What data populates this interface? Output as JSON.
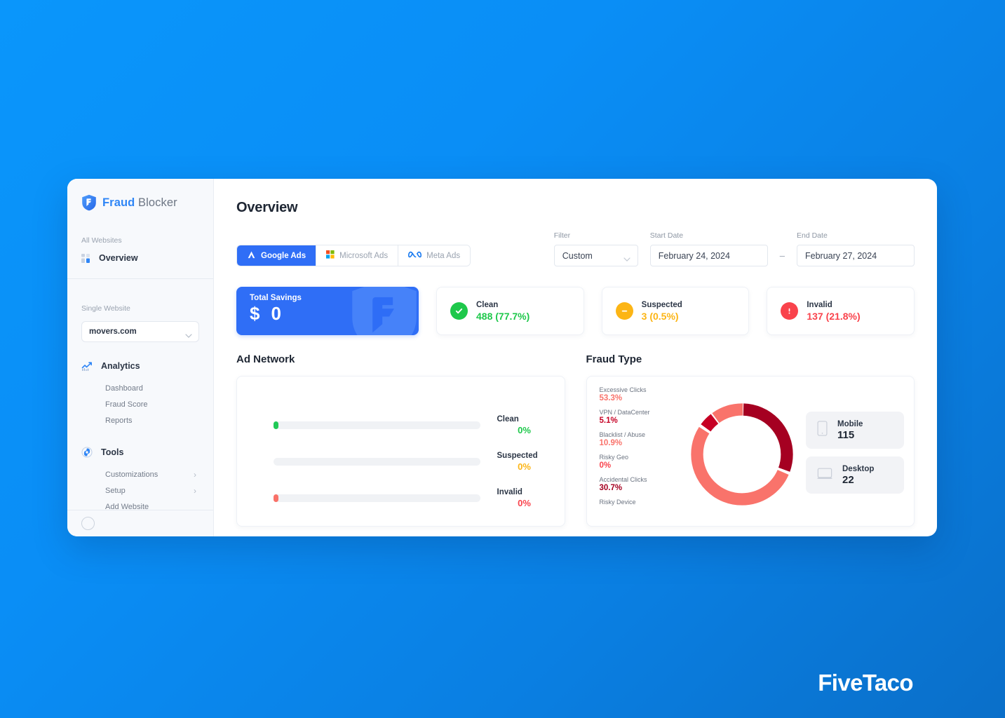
{
  "brand": {
    "part1": "Fraud",
    "part2": "Blocker",
    "icon": "shield-logo-icon"
  },
  "sidebar": {
    "all_websites_label": "All Websites",
    "overview_label": "Overview",
    "single_website_label": "Single Website",
    "selected_website": "movers.com",
    "groups": [
      {
        "title": "Analytics",
        "icon": "analytics-chart-icon",
        "items": [
          {
            "label": "Dashboard",
            "arrow": ""
          },
          {
            "label": "Fraud Score",
            "arrow": ""
          },
          {
            "label": "Reports",
            "arrow": ""
          }
        ]
      },
      {
        "title": "Tools",
        "icon": "gear-icon",
        "items": [
          {
            "label": "Customizations",
            "arrow": "›"
          },
          {
            "label": "Setup",
            "arrow": "›"
          },
          {
            "label": "Add Website",
            "arrow": ""
          }
        ]
      }
    ]
  },
  "header": {
    "title": "Overview"
  },
  "networks": [
    {
      "label": "Google Ads",
      "icon": "google-ads-icon",
      "active": true
    },
    {
      "label": "Microsoft Ads",
      "icon": "microsoft-ads-icon",
      "active": false
    },
    {
      "label": "Meta Ads",
      "icon": "meta-ads-icon",
      "active": false
    }
  ],
  "filters": {
    "filter_label": "Filter",
    "filter_value": "Custom",
    "start_label": "Start Date",
    "start_value": "February 24, 2024",
    "separator": "–",
    "end_label": "End Date",
    "end_value": "February 27, 2024"
  },
  "savings": {
    "label": "Total Savings",
    "currency": "$",
    "amount": "0"
  },
  "stats": [
    {
      "name": "Clean",
      "value": "488 (77.7%)",
      "icon": "check-circle-icon",
      "color": "#1ec84b"
    },
    {
      "name": "Suspected",
      "value": "3 (0.5%)",
      "icon": "minus-circle-icon",
      "color": "#fcb515"
    },
    {
      "name": "Invalid",
      "value": "137 (21.8%)",
      "icon": "alert-circle-icon",
      "color": "#f9434c"
    }
  ],
  "ad_network": {
    "title": "Ad Network",
    "rows": [
      {
        "name": "Clean",
        "pct": "0%",
        "color": "#20c957"
      },
      {
        "name": "Suspected",
        "pct": "0%",
        "color": "#fcb515"
      },
      {
        "name": "Invalid",
        "pct": "0%",
        "color": "#f97168"
      }
    ]
  },
  "fraud_type": {
    "title": "Fraud Type",
    "legend": [
      {
        "name": "Excessive Clicks",
        "pct": "53.3%",
        "color": "#f9736b"
      },
      {
        "name": "VPN / DataCenter",
        "pct": "5.1%",
        "color": "#c60024"
      },
      {
        "name": "Blacklist / Abuse",
        "pct": "10.9%",
        "color": "#f9736b"
      },
      {
        "name": "Risky Geo",
        "pct": "0%",
        "color": "#f9434c"
      },
      {
        "name": "Accidental Clicks",
        "pct": "30.7%",
        "color": "#a50021"
      },
      {
        "name": "Risky Device",
        "pct": "",
        "color": "#f9736b"
      }
    ],
    "devices": [
      {
        "name": "Mobile",
        "value": "115",
        "icon": "mobile-phone-icon"
      },
      {
        "name": "Desktop",
        "value": "22",
        "icon": "desktop-monitor-icon"
      }
    ]
  },
  "chart_data": {
    "type": "pie",
    "title": "Fraud Type",
    "labels": [
      "Accidental Clicks",
      "Excessive Clicks",
      "VPN / DataCenter",
      "Blacklist / Abuse",
      "Risky Geo"
    ],
    "values": [
      30.7,
      53.3,
      5.1,
      10.9,
      0
    ],
    "colors": [
      "#a50021",
      "#f9736b",
      "#c60024",
      "#f9736b",
      "#f9434c"
    ],
    "unit": "%",
    "legend": "left",
    "donut": true
  },
  "watermark": "FiveTaco",
  "theme": {
    "accent": "#2f6ef6",
    "page_bg_from": "#0a96fb",
    "page_bg_to": "#0a6fc9"
  }
}
